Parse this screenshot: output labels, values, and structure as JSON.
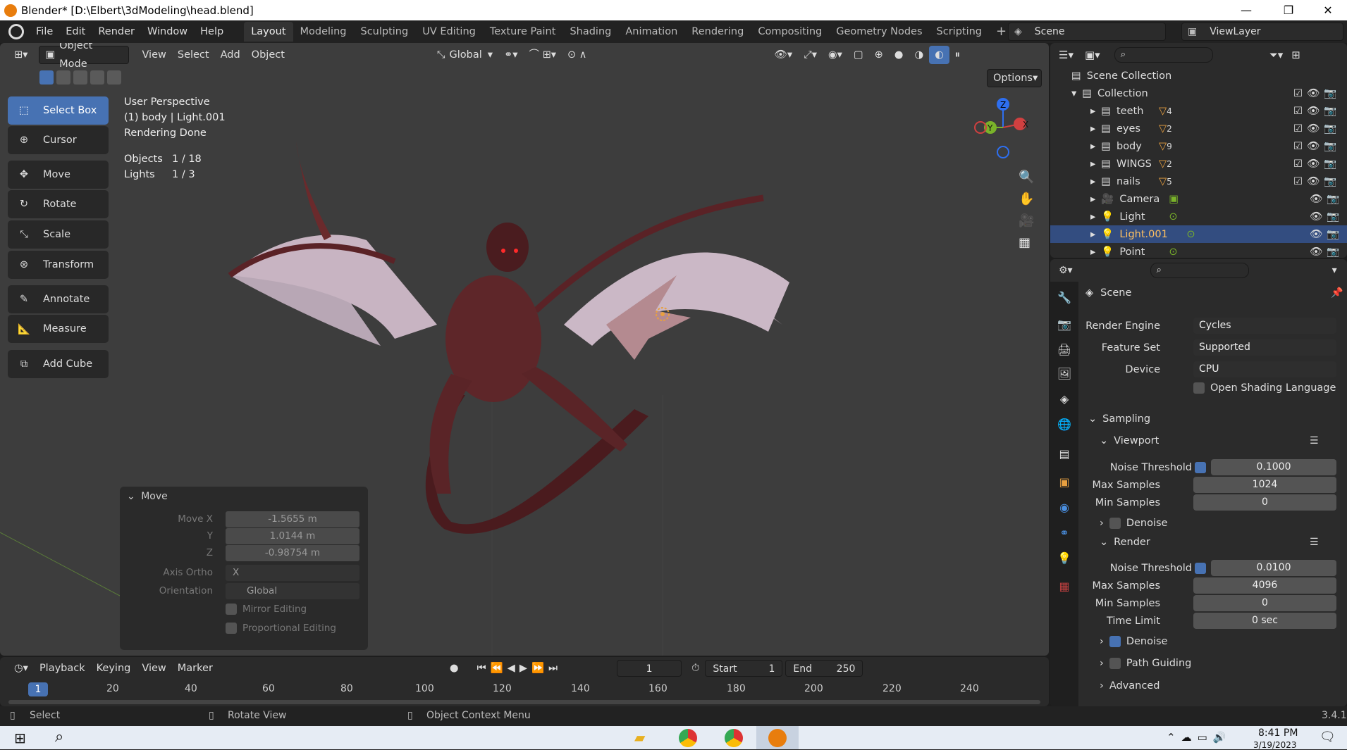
{
  "titlebar": {
    "title": "Blender* [D:\\Elbert\\3dModeling\\head.blend]",
    "minimize": "—",
    "maximize": "❐",
    "close": "✕"
  },
  "menubar": {
    "menus": [
      "File",
      "Edit",
      "Render",
      "Window",
      "Help"
    ],
    "workspaces": [
      "Layout",
      "Modeling",
      "Sculpting",
      "UV Editing",
      "Texture Paint",
      "Shading",
      "Animation",
      "Rendering",
      "Compositing",
      "Geometry Nodes",
      "Scripting"
    ],
    "add_workspace": "+",
    "scene_label": "Scene",
    "viewlayer_label": "ViewLayer"
  },
  "viewport": {
    "mode": "Object Mode",
    "menus": [
      "View",
      "Select",
      "Add",
      "Object"
    ],
    "orientation": "Global",
    "options": "Options",
    "info_line1": "User Perspective",
    "info_line2": "(1) body | Light.001",
    "info_line3": "Rendering Done",
    "objects_label": "Objects",
    "objects_value": "1 / 18",
    "lights_label": "Lights",
    "lights_value": "1 / 3",
    "gizmo": {
      "z": "Z",
      "y": "Y",
      "x": "X"
    }
  },
  "tools": [
    {
      "label": "Select Box",
      "icon": "select-box-icon"
    },
    {
      "label": "Cursor",
      "icon": "cursor-icon"
    },
    {
      "label": "Move",
      "icon": "move-icon"
    },
    {
      "label": "Rotate",
      "icon": "rotate-icon"
    },
    {
      "label": "Scale",
      "icon": "scale-icon"
    },
    {
      "label": "Transform",
      "icon": "transform-icon"
    },
    {
      "label": "Annotate",
      "icon": "annotate-icon"
    },
    {
      "label": "Measure",
      "icon": "measure-icon"
    },
    {
      "label": "Add Cube",
      "icon": "add-cube-icon"
    }
  ],
  "move_panel": {
    "title": "Move",
    "move_x_label": "Move X",
    "move_x": "-1.5655 m",
    "y_label": "Y",
    "y": "1.0144 m",
    "z_label": "Z",
    "z": "-0.98754 m",
    "axis_ortho_label": "Axis Ortho",
    "axis_ortho": "X",
    "orientation_label": "Orientation",
    "orientation": "Global",
    "mirror_editing": "Mirror Editing",
    "proportional_editing": "Proportional Editing"
  },
  "timeline": {
    "menus": [
      "Playback",
      "Keying",
      "View",
      "Marker"
    ],
    "current_frame": "1",
    "start_label": "Start",
    "start": "1",
    "end_label": "End",
    "end": "250",
    "ticks": [
      "1",
      "20",
      "40",
      "60",
      "80",
      "100",
      "120",
      "140",
      "160",
      "180",
      "200",
      "220",
      "240"
    ]
  },
  "statusbar": {
    "select": "Select",
    "rotate_view": "Rotate View",
    "context_menu": "Object Context Menu",
    "version": "3.4.1"
  },
  "taskbar": {
    "time": "8:41 PM",
    "date": "3/19/2023"
  },
  "outliner": {
    "scene_collection": "Scene Collection",
    "collection": "Collection",
    "items": [
      {
        "name": "teeth",
        "badge": "4"
      },
      {
        "name": "eyes",
        "badge": "2"
      },
      {
        "name": "body",
        "badge": "9"
      },
      {
        "name": "WINGS",
        "badge": "2"
      },
      {
        "name": "nails",
        "badge": "5"
      },
      {
        "name": "Camera",
        "badge": ""
      },
      {
        "name": "Light",
        "badge": ""
      },
      {
        "name": "Light.001",
        "badge": ""
      },
      {
        "name": "Point",
        "badge": ""
      }
    ]
  },
  "properties": {
    "scene_title": "Scene",
    "render_engine_label": "Render Engine",
    "render_engine": "Cycles",
    "feature_set_label": "Feature Set",
    "feature_set": "Supported",
    "device_label": "Device",
    "device": "CPU",
    "osl": "Open Shading Language",
    "sampling": "Sampling",
    "viewport": "Viewport",
    "vp_noise_label": "Noise Threshold",
    "vp_noise": "0.1000",
    "vp_max_label": "Max Samples",
    "vp_max": "1024",
    "vp_min_label": "Min Samples",
    "vp_min": "0",
    "vp_denoise": "Denoise",
    "render": "Render",
    "r_noise_label": "Noise Threshold",
    "r_noise": "0.0100",
    "r_max_label": "Max Samples",
    "r_max": "4096",
    "r_min_label": "Min Samples",
    "r_min": "0",
    "r_time_label": "Time Limit",
    "r_time": "0 sec",
    "r_denoise": "Denoise",
    "path_guiding": "Path Guiding",
    "advanced": "Advanced"
  },
  "colors": {
    "accent": "#4772b3",
    "selected_row": "#334d80",
    "viewport_bg": "#3d3d3d"
  }
}
